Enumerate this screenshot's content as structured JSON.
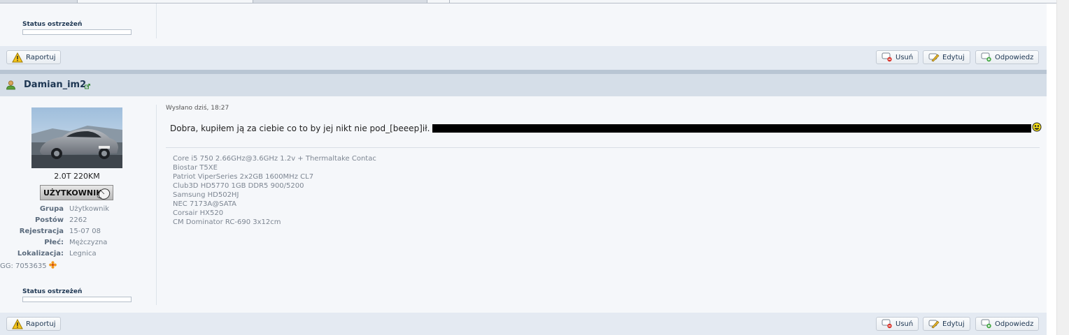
{
  "post_top": {
    "warning_status_label": "Status ostrzeżeń",
    "actions": {
      "report": "Raportuj",
      "delete": "Usuń",
      "edit": "Edytuj",
      "reply": "Odpowiedz"
    }
  },
  "post": {
    "author": "Damian_im2",
    "avatar_caption": "2.0T 220KM",
    "rank_badge": "UŻYTKOWNIK",
    "info": [
      {
        "key": "Grupa",
        "value": "Użytkownik"
      },
      {
        "key": "Postów",
        "value": "2262"
      },
      {
        "key": "Rejestracja",
        "value": "15-07 08"
      },
      {
        "key": "Płeć:",
        "value": "Mężczyzna"
      },
      {
        "key": "Lokalizacja:",
        "value": "Legnica"
      }
    ],
    "gg": "GG: 7053635",
    "warning_status_label": "Status ostrzeżeń",
    "posted": "Wysłano dziś, 18:27",
    "message": "Dobra, kupiłem ją za ciebie co to by jej nikt nie pod_[beeep]ił.",
    "signature": [
      "Core i5 750 2.66GHz@3.6GHz 1.2v + Thermaltake Contac",
      "Biostar T5XE",
      "Patriot ViperSeries 2x2GB 1600MHz CL7",
      "Club3D HD5770 1GB DDR5 900/5200",
      "Samsung HD502HJ",
      "NEC 7173A@SATA",
      "Corsair HX520",
      "CM Dominator RC-690 3x12cm"
    ],
    "actions": {
      "report": "Raportuj",
      "delete": "Usuń",
      "edit": "Edytuj",
      "reply": "Odpowiedz"
    }
  },
  "icons": {
    "warning": "warning-triangle-icon",
    "delete": "delete-comment-icon",
    "edit": "edit-pencil-icon",
    "reply": "reply-comment-icon",
    "user": "user-icon",
    "gg": "gg-flower-icon"
  },
  "colors": {
    "accent": "#1d3652",
    "bar": "#e4eaf2",
    "post_bg": "#f5f7fa",
    "header_bg": "#d5dee8"
  }
}
